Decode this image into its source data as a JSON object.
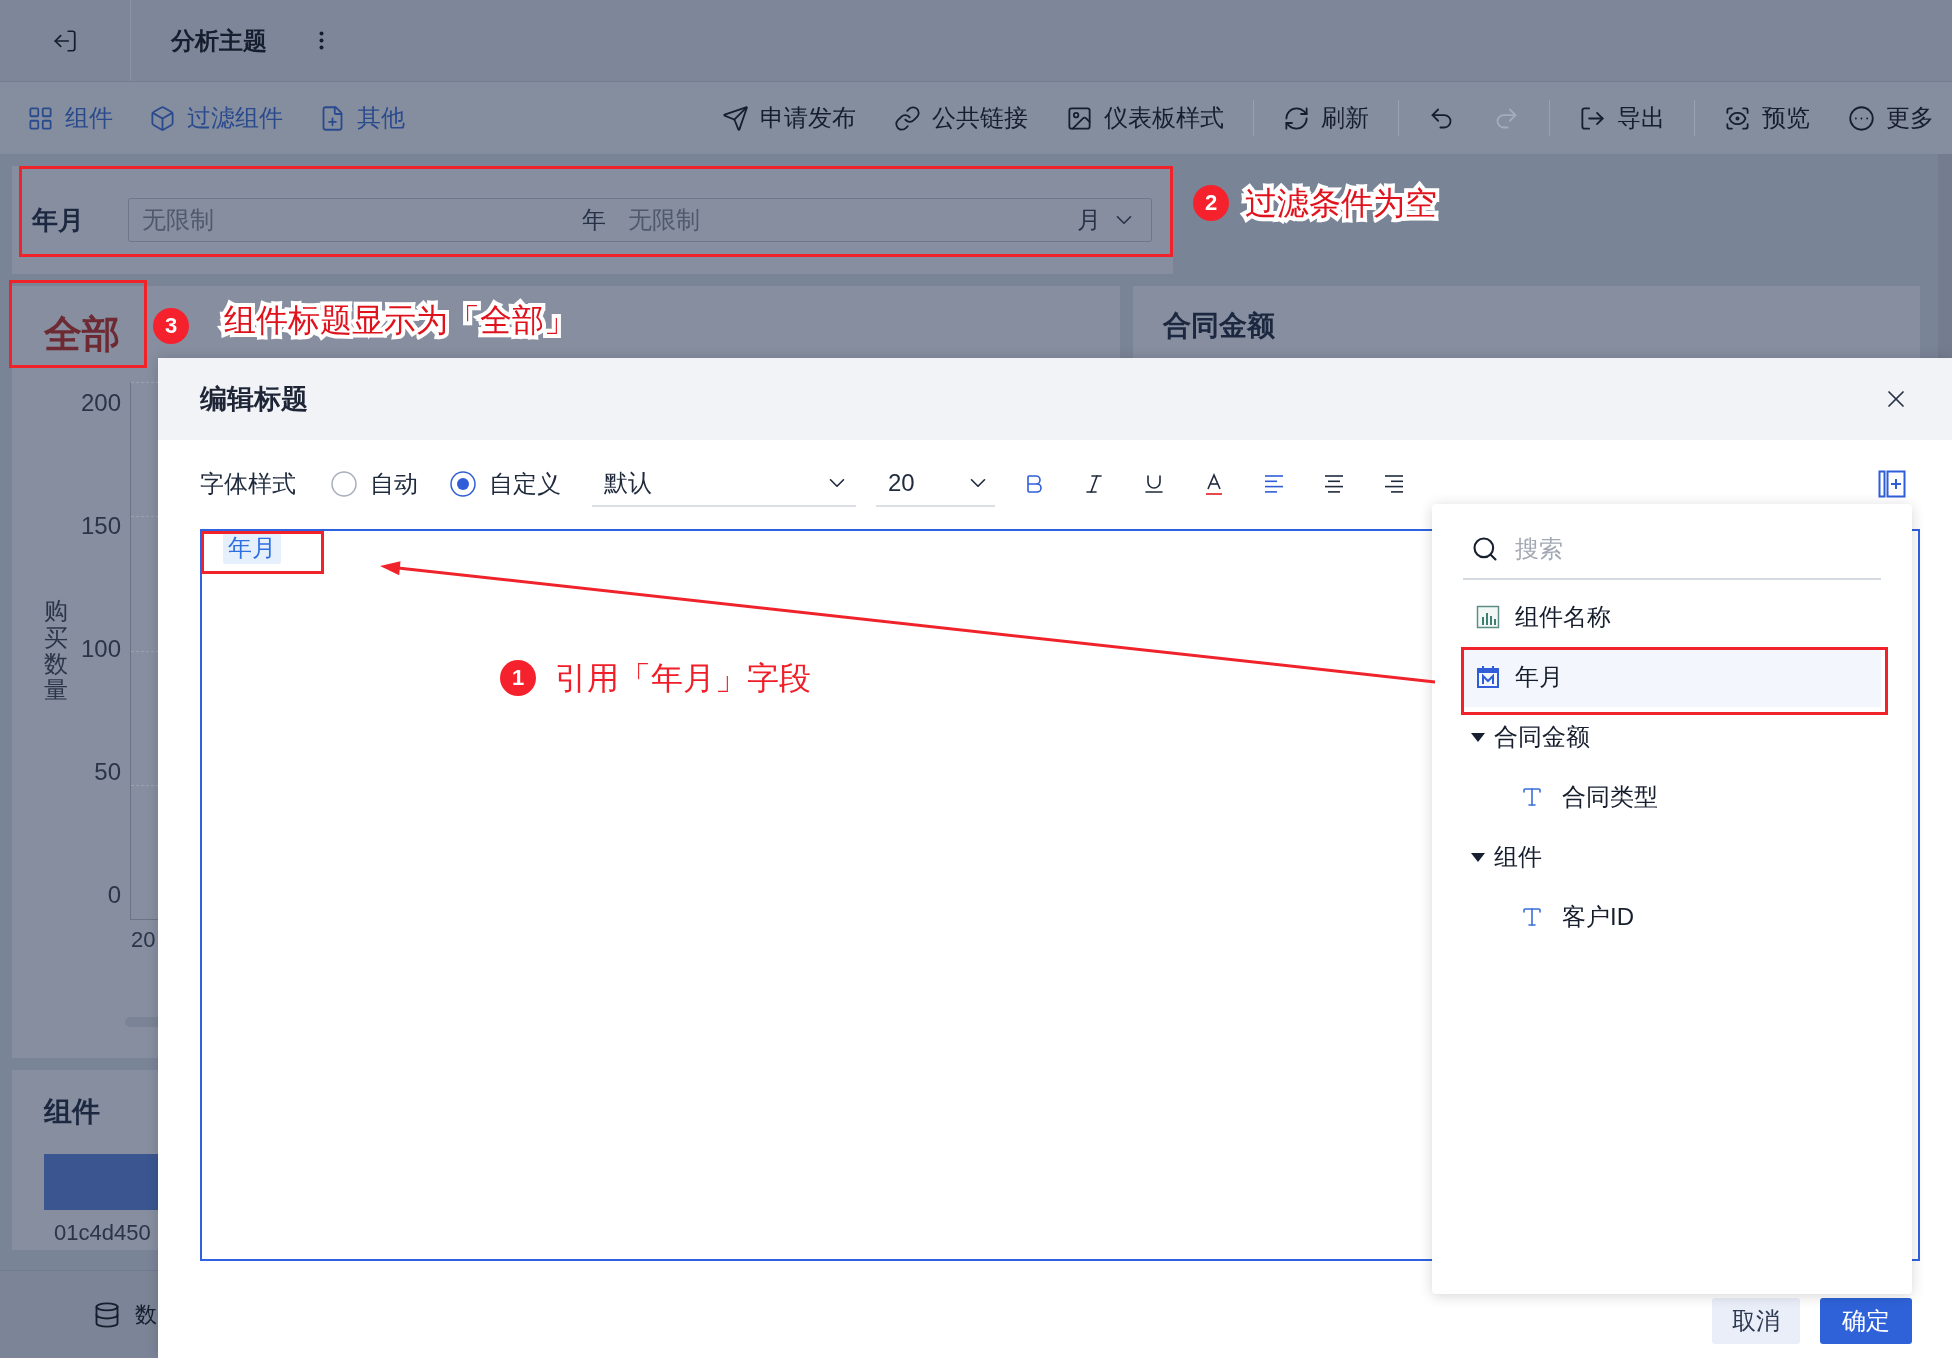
{
  "top_bar": {
    "title": "分析主题"
  },
  "toolbar": {
    "left": [
      {
        "kind": "component",
        "label": "组件"
      },
      {
        "kind": "filter",
        "label": "过滤组件"
      },
      {
        "kind": "other",
        "label": "其他"
      }
    ],
    "right_groups": [
      {
        "items": [
          {
            "kind": "publish",
            "label": "申请发布"
          },
          {
            "kind": "link",
            "label": "公共链接"
          },
          {
            "kind": "style",
            "label": "仪表板样式"
          }
        ]
      },
      {
        "items": [
          {
            "kind": "refresh",
            "label": "刷新"
          }
        ]
      },
      {
        "items": [
          {
            "kind": "undo",
            "disabled": false
          },
          {
            "kind": "redo",
            "disabled": true
          }
        ]
      },
      {
        "items": [
          {
            "kind": "export",
            "label": "导出"
          }
        ]
      },
      {
        "items": [
          {
            "kind": "preview",
            "label": "预览"
          },
          {
            "kind": "more",
            "label": "更多"
          }
        ]
      }
    ]
  },
  "filter": {
    "label": "年月",
    "start_placeholder": "无限制",
    "start_unit": "年",
    "end_placeholder": "无限制",
    "end_unit": "月"
  },
  "chart_card": {
    "title": "全部",
    "y_axis_title": "购买数量",
    "y_ticks": [
      "200",
      "150",
      "100",
      "50",
      "0"
    ],
    "x_label": "20"
  },
  "side_card": {
    "title": "合同金额"
  },
  "table_card": {
    "title": "组件",
    "cell": "01c4d450"
  },
  "bottom_bar": {
    "label": "数"
  },
  "dialog": {
    "title": "编辑标题",
    "font_label": "字体样式",
    "modes": [
      {
        "label": "自动",
        "selected": false
      },
      {
        "label": "自定义",
        "selected": true
      }
    ],
    "font": {
      "value": "默认"
    },
    "size": {
      "value": "20"
    },
    "format": [
      {
        "kind": "bold",
        "active": true
      },
      {
        "kind": "italic",
        "active": false
      },
      {
        "kind": "underline",
        "active": false
      },
      {
        "kind": "color",
        "active": false
      }
    ],
    "align": [
      {
        "kind": "left",
        "selected": true
      },
      {
        "kind": "center",
        "selected": false
      },
      {
        "kind": "right",
        "selected": false
      }
    ],
    "editor": {
      "tokens": [
        {
          "label": "年月"
        }
      ]
    },
    "buttons": [
      {
        "kind": "cancel",
        "label": "取消"
      },
      {
        "kind": "confirm",
        "label": "确定"
      }
    ]
  },
  "field_picker": {
    "search": {
      "placeholder": "搜索"
    },
    "items": [
      {
        "kind": "chart",
        "label": "组件名称",
        "selected": false
      },
      {
        "kind": "date",
        "label": "年月",
        "selected": true
      },
      {
        "kind": "group",
        "label": "合同金额",
        "selected": false,
        "expanded": true,
        "children": [
          {
            "kind": "text",
            "label": "合同类型",
            "selected": false
          }
        ]
      },
      {
        "kind": "group",
        "label": "组件",
        "selected": false,
        "expanded": true,
        "children": [
          {
            "kind": "text",
            "label": "客户ID",
            "selected": false
          }
        ]
      }
    ]
  },
  "annotations": [
    {
      "kind": "filter",
      "number": "2",
      "text": "过滤条件为空"
    },
    {
      "kind": "title",
      "number": "3",
      "text": "组件标题显示为「全部」"
    },
    {
      "kind": "editor",
      "number": "1",
      "text": "引用「年月」字段"
    }
  ]
}
